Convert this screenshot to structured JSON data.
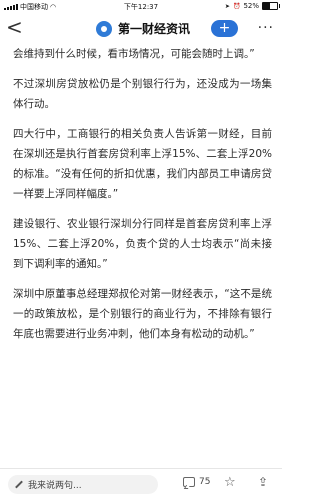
{
  "status": {
    "carrier": "中国移动",
    "time": "下午12:37",
    "battery": "52%",
    "battery_level": 0.52
  },
  "nav": {
    "back_glyph": "<",
    "title": "第一财经资讯",
    "plus_glyph": "+",
    "more_glyph": "..."
  },
  "article": {
    "paragraphs": [
      "会维持到什么时候，看市场情况，可能会随时上调。”",
      "不过深圳房贷放松仍是个别银行行为，还没成为一场集体行动。",
      "四大行中，工商银行的相关负责人告诉第一财经，目前在深圳还是执行首套房贷利率上浮15%、二套上浮20%的标准。“没有任何的折扣优惠，我们内部员工申请房贷一样要上浮同样幅度。”",
      "建设银行、农业银行深圳分行同样是首套房贷利率上浮15%、二套上浮20%，负责个贷的人士均表示“尚未接到下调利率的通知。”",
      "深圳中原董事总经理郑叔伦对第一财经表示，“这不是统一的政策放松，是个别银行的商业行为，不排除有银行年底也需要进行业务冲刺，他们本身有松动的动机。”"
    ]
  },
  "bottom": {
    "comment_placeholder": "我来说两句...",
    "comment_count": "75",
    "star_glyph": "☆",
    "share_glyph": "⇪"
  }
}
